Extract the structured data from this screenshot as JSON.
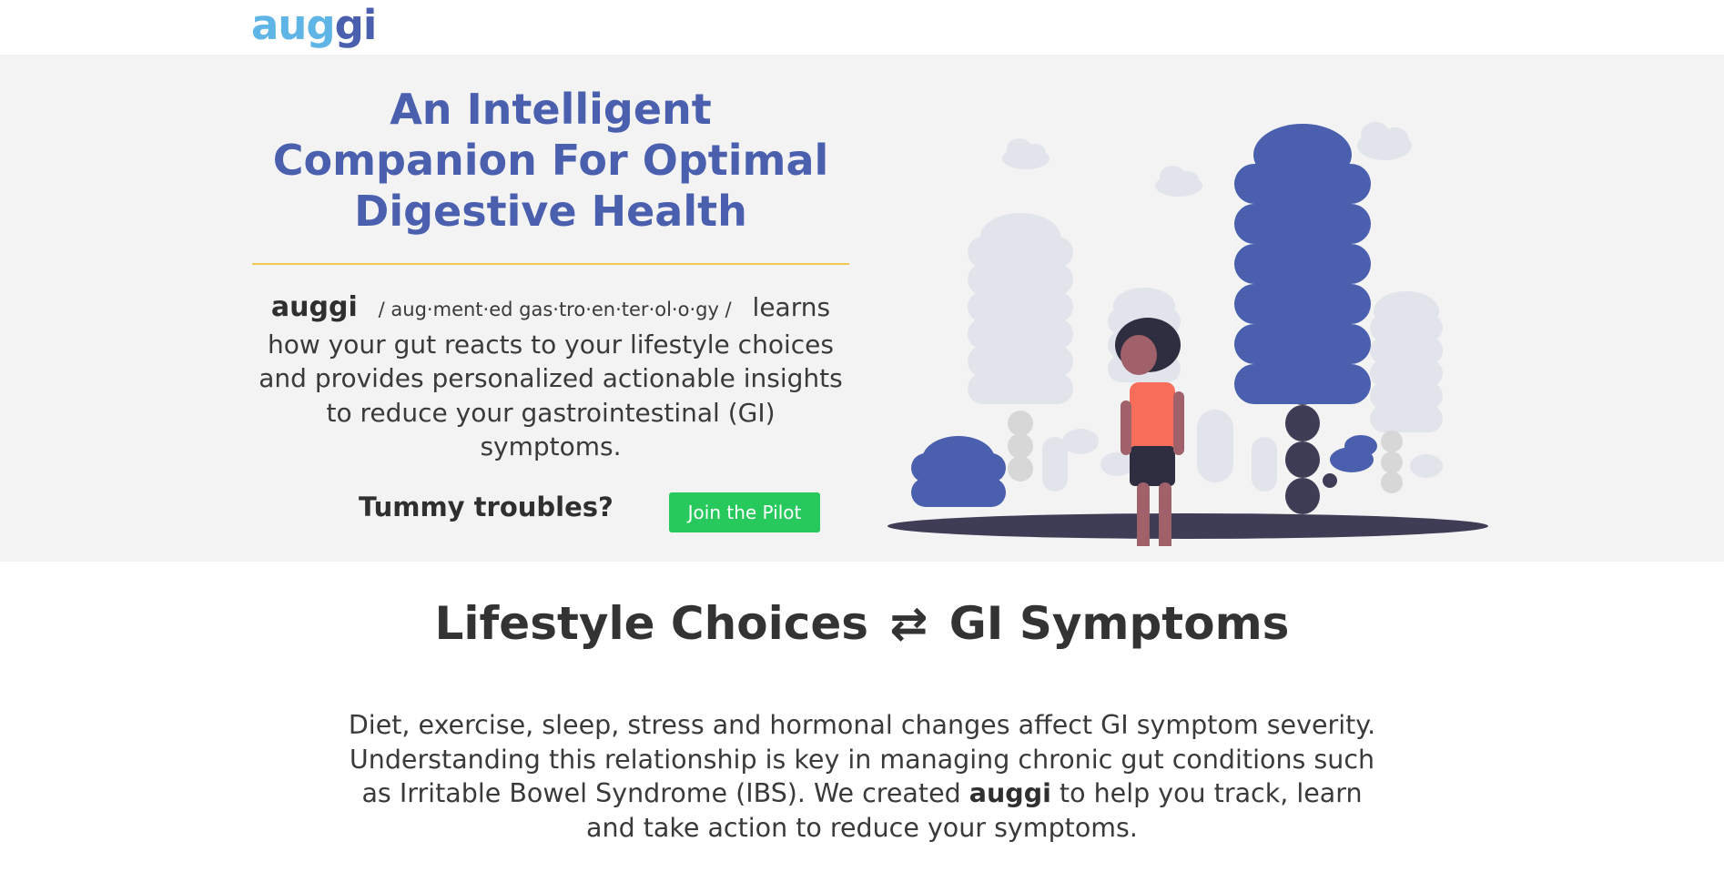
{
  "header": {
    "logo_part1": "aug",
    "logo_part2": "gi"
  },
  "hero": {
    "title": "An Intelligent Companion For Optimal Digestive Health",
    "brand": "auggi",
    "phonetic": "/ aug·ment·ed gas·tro·en·ter·ol·o·gy /",
    "description": "learns how your gut reacts to your lifestyle choices and provides personalized actionable insights to reduce your gastrointestinal (GI) symptoms.",
    "tummy_text": "Tummy troubles?",
    "cta_label": "Join the Pilot"
  },
  "section": {
    "title_left": "Lifestyle Choices",
    "title_arrow": "⇄",
    "title_right": "GI Symptoms",
    "body_before": "Diet, exercise, sleep, stress and hormonal changes affect GI symptom severity. Understanding this relationship is key in managing chronic gut conditions such as Irritable Bowel Syndrome (IBS). We created",
    "body_brand": "auggi",
    "body_after": "to help you track, learn and take action to reduce your symptoms."
  },
  "colors": {
    "brand_blue": "#4a5fae",
    "logo_light_blue": "#5fb6e6",
    "divider_yellow": "#f2c94c",
    "cta_green": "#27c95c",
    "hero_bg": "#f3f3f3",
    "shirt_coral": "#f96e5a",
    "ground_dark": "#3f3d56"
  },
  "icons": {
    "illustration": "woman-with-phone-among-trees-illustration",
    "arrow": "left-right-arrows-icon"
  }
}
